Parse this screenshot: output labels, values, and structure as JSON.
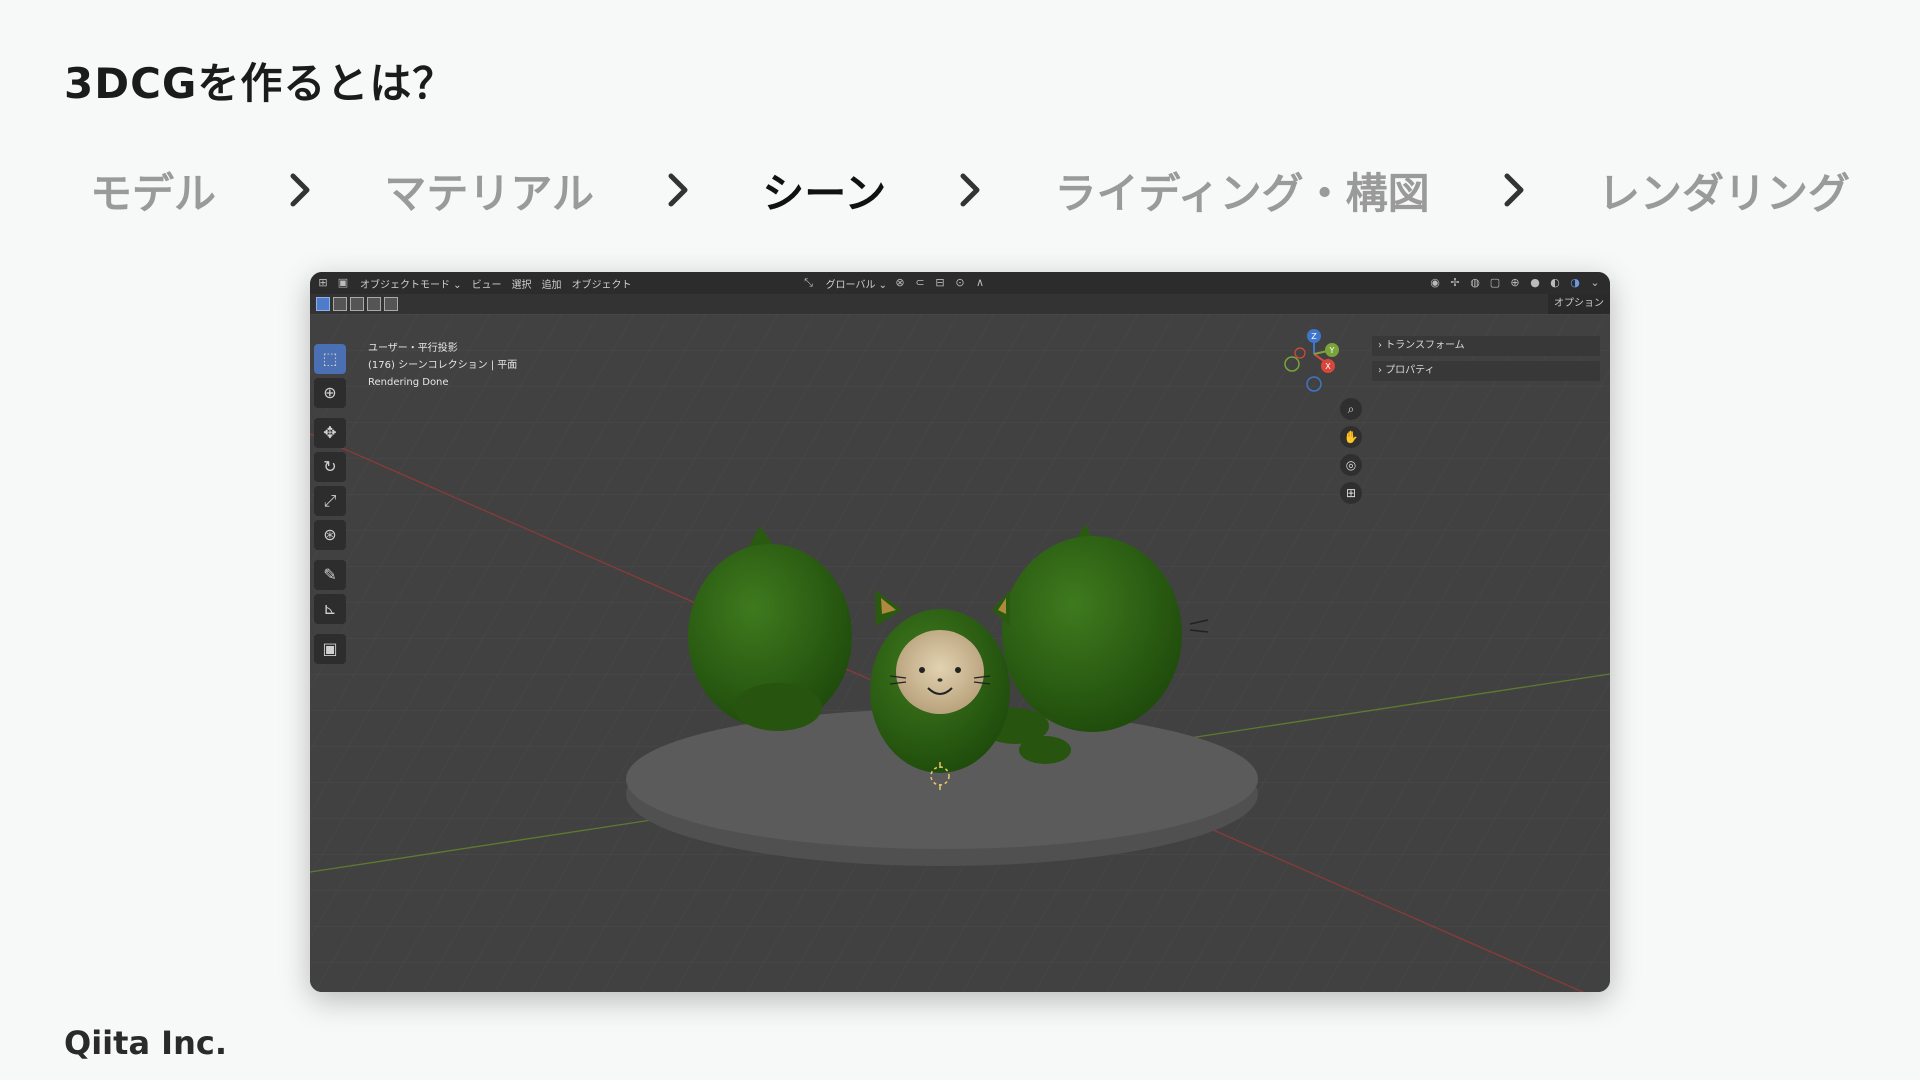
{
  "title": "3DCGを作るとは？",
  "steps": [
    {
      "label": "モデル",
      "active": false
    },
    {
      "label": "マテリアル",
      "active": false
    },
    {
      "label": "シーン",
      "active": true
    },
    {
      "label": "ライディング・構図",
      "active": false
    },
    {
      "label": "レンダリング",
      "active": false
    }
  ],
  "footer": "Qiita Inc.",
  "blender": {
    "header": {
      "mode": "オブジェクトモード",
      "menus": [
        "ビュー",
        "選択",
        "追加",
        "オブジェクト"
      ],
      "orientation": "グローバル"
    },
    "options_label": "オプション",
    "viewport_info": {
      "view": "ユーザー・平行投影",
      "collection": "(176) シーンコレクション | 平面",
      "status": "Rendering Done"
    },
    "n_panel": [
      "トランスフォーム",
      "プロパティ"
    ],
    "gizmo_axes": [
      "Z",
      "Y",
      "X"
    ],
    "colors": {
      "axis_x": "#d9473c",
      "axis_y": "#7aa33a",
      "axis_z": "#3f76c9",
      "character": "#2d5e14"
    }
  }
}
